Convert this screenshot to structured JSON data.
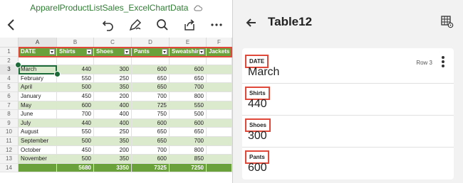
{
  "file": {
    "title": "ApparelProductListSales_ExcelChartData"
  },
  "toolbar": {
    "icons": [
      "back-icon",
      "undo-icon",
      "draw-icon",
      "search-icon",
      "share-icon",
      "more-icon"
    ]
  },
  "sheet": {
    "columns": [
      "A",
      "B",
      "C",
      "D",
      "E",
      "F"
    ],
    "header_row": [
      "DATE",
      "Shirts",
      "Shoes",
      "Pants",
      "Sweatshirts",
      "Jackets"
    ],
    "row_numbers": [
      "1",
      "2",
      "3",
      "4",
      "5",
      "6",
      "7",
      "8",
      "9",
      "10",
      "11",
      "12",
      "13",
      "14"
    ],
    "rows": [
      [
        "",
        "",
        "",
        "",
        "",
        ""
      ],
      [
        "March",
        "440",
        "300",
        "600",
        "600",
        ""
      ],
      [
        "February",
        "550",
        "250",
        "650",
        "650",
        ""
      ],
      [
        "April",
        "500",
        "350",
        "650",
        "700",
        ""
      ],
      [
        "January",
        "450",
        "200",
        "700",
        "800",
        ""
      ],
      [
        "May",
        "600",
        "400",
        "725",
        "550",
        ""
      ],
      [
        "June",
        "700",
        "400",
        "750",
        "500",
        ""
      ],
      [
        "July",
        "440",
        "400",
        "600",
        "600",
        ""
      ],
      [
        "August",
        "550",
        "250",
        "650",
        "650",
        ""
      ],
      [
        "September",
        "500",
        "350",
        "650",
        "700",
        ""
      ],
      [
        "October",
        "450",
        "200",
        "700",
        "800",
        ""
      ],
      [
        "November",
        "500",
        "350",
        "600",
        "850",
        ""
      ],
      [
        "",
        "5680",
        "3350",
        "7325",
        "7250",
        ""
      ]
    ]
  },
  "card": {
    "title": "Table12",
    "row_indicator": "Row 3",
    "fields": [
      {
        "label": "DATE",
        "value": "March"
      },
      {
        "label": "Shirts",
        "value": "440"
      },
      {
        "label": "Shoes",
        "value": "300"
      },
      {
        "label": "Pants",
        "value": "600"
      }
    ]
  },
  "colors": {
    "accent_green": "#6aa13b",
    "highlight_red": "#e0483a",
    "selection_green": "#1e6b3a",
    "title_green": "#2e7d32"
  }
}
